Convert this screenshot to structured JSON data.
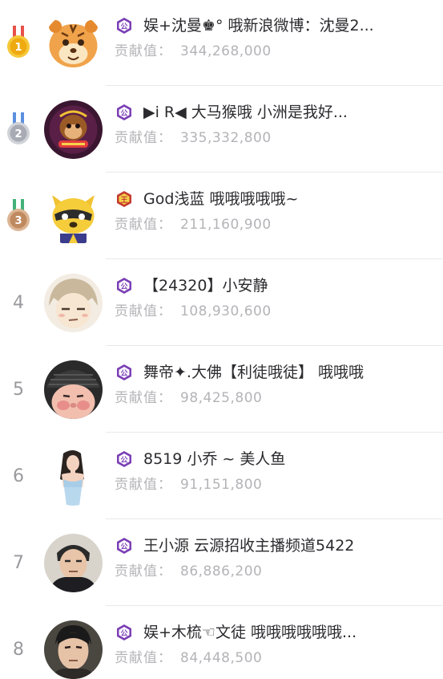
{
  "leaderboard": {
    "contribution_label": "贡献值：",
    "rows": [
      {
        "rank": "1",
        "medal": "gold",
        "badge": "公",
        "badge_type": "guild",
        "name": "娱+沈曼♚° 哦新浪微博：沈曼2...",
        "value": "344,268,000",
        "avatar": "tiger-avatar"
      },
      {
        "rank": "2",
        "medal": "silver",
        "badge": "公",
        "badge_type": "guild",
        "name": "▶i R◀ 大马猴哦 小洲是我好...",
        "value": "335,332,800",
        "avatar": "monkey-avatar"
      },
      {
        "rank": "3",
        "medal": "bronze",
        "badge": "王",
        "badge_type": "king",
        "name": "God浅蓝 哦哦哦哦哦~",
        "value": "211,160,900",
        "avatar": "raccoon-avatar"
      },
      {
        "rank": "4",
        "medal": "",
        "badge": "公",
        "badge_type": "guild",
        "name": "【24320】小安静",
        "value": "108,930,600",
        "avatar": "anime-avatar"
      },
      {
        "rank": "5",
        "medal": "",
        "badge": "公",
        "badge_type": "guild",
        "name": "舞帝✦.大佛【利徒哦徒】 哦哦哦",
        "value": "98,425,800",
        "avatar": "face-hat-avatar"
      },
      {
        "rank": "6",
        "medal": "",
        "badge": "公",
        "badge_type": "guild",
        "name": "8519 小乔 ~ 美人鱼",
        "value": "91,151,800",
        "avatar": "girl-avatar"
      },
      {
        "rank": "7",
        "medal": "",
        "badge": "公",
        "badge_type": "guild",
        "name": "王小源 云源招收主播频道5422",
        "value": "86,886,200",
        "avatar": "man-avatar"
      },
      {
        "rank": "8",
        "medal": "",
        "badge": "公",
        "badge_type": "guild",
        "name": "娱+木梳☜文徒 哦哦哦哦哦哦...",
        "value": "84,448,500",
        "avatar": "man-portrait-avatar"
      }
    ]
  },
  "colors": {
    "guild_badge": "#7b3fb5",
    "king_badge": "#c43a2f",
    "gold": "#f2b61c",
    "silver": "#b9bcc4",
    "bronze": "#c89a72",
    "separator": "#e9e9ec"
  }
}
